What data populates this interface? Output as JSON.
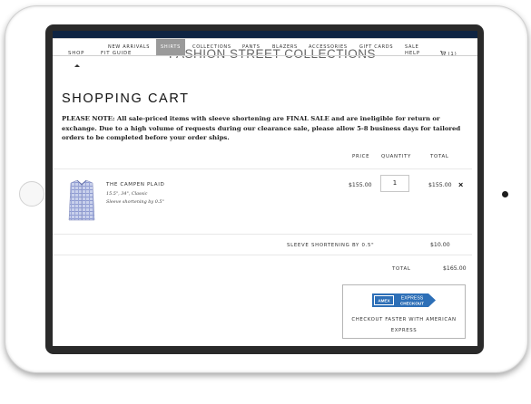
{
  "header": {
    "shop": "SHOP",
    "fit_guide": "FIT GUIDE",
    "brand": "FASHION STREET COLLECTIONS",
    "help": "HELP",
    "cart_count": "(1)"
  },
  "subnav": [
    "NEW ARRIVALS",
    "SHIRTS",
    "COLLECTIONS",
    "PANTS",
    "BLAZERS",
    "ACCESSORIES",
    "GIFT CARDS",
    "SALE"
  ],
  "cart": {
    "title": "SHOPPING CART",
    "notice": "PLEASE NOTE: All sale-priced items with sleeve shortening are FINAL SALE and are ineligible for return or exchange. Due to a high volume of requests during our clearance sale, please allow 5-8 business days for tailored orders to be completed before your order ships.",
    "columns": {
      "price": "PRICE",
      "quantity": "QUANTITY",
      "total": "TOTAL"
    },
    "item": {
      "name": "THE CAMPEN PLAID",
      "size": "15.5\", 34\", Classic",
      "alteration": "Sleeve shortening by 0.5\"",
      "price": "$155.00",
      "quantity": "1",
      "total": "$155.00",
      "remove": "×"
    },
    "surcharge": {
      "label": "SLEEVE SHORTENING BY 0.5\"",
      "amount": "$10.00"
    },
    "total": {
      "label": "TOTAL",
      "amount": "$165.00"
    }
  },
  "checkout": {
    "badge_line1": "AMEX",
    "badge_line2": "EXPRESS",
    "badge_line3": "CHECKOUT",
    "text": "CHECKOUT FASTER WITH AMERICAN EXPRESS"
  },
  "colors": {
    "topbar": "#0f2442",
    "amex_blue": "#2d6fb7",
    "active_tab": "#9a9a9a"
  }
}
